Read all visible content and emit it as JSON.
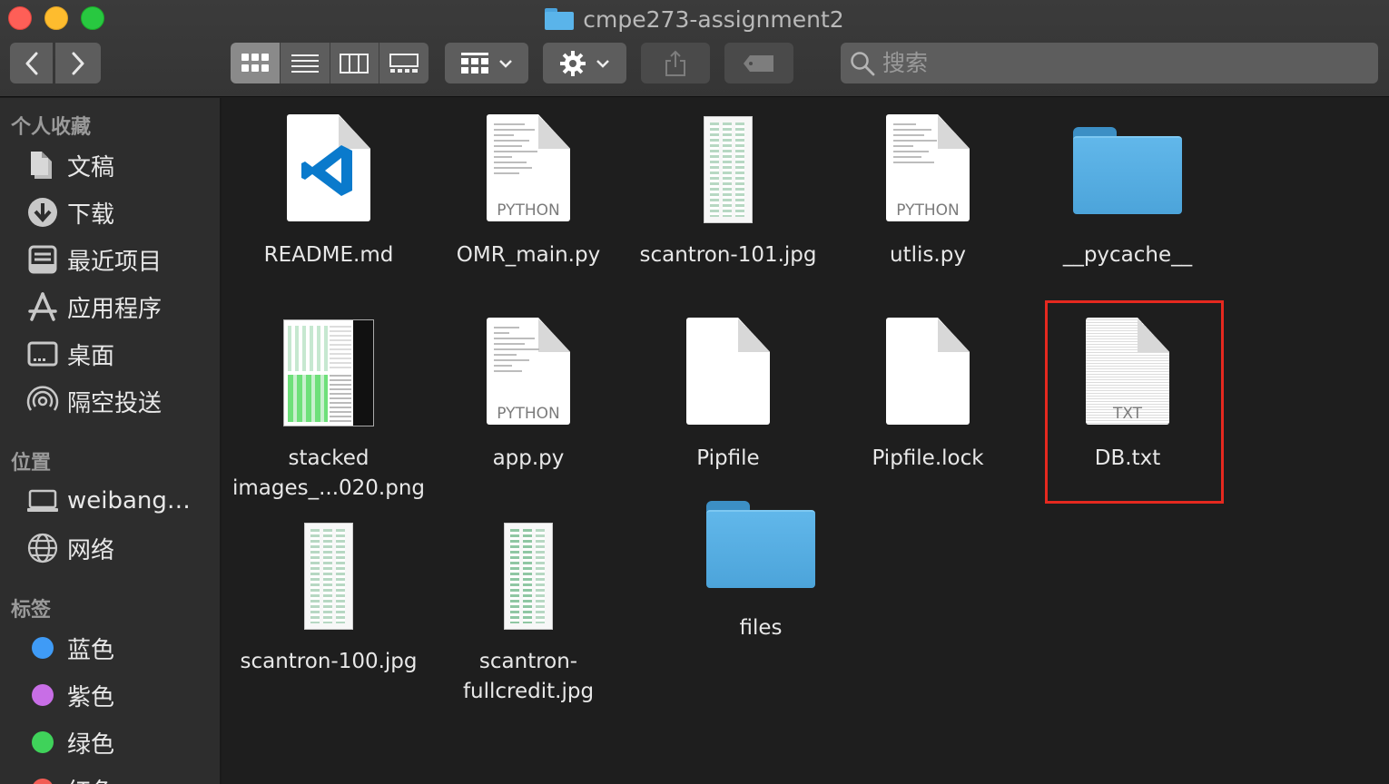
{
  "window": {
    "title": "cmpe273-assignment2"
  },
  "toolbar": {
    "search_placeholder": "搜索",
    "views": [
      "icon",
      "list",
      "column",
      "gallery"
    ],
    "active_view": "icon"
  },
  "sidebar": {
    "favorites_header": "个人收藏",
    "favorites": [
      {
        "label": "文稿",
        "icon": "documents-icon"
      },
      {
        "label": "下载",
        "icon": "downloads-icon"
      },
      {
        "label": "最近项目",
        "icon": "recents-icon"
      },
      {
        "label": "应用程序",
        "icon": "applications-icon"
      },
      {
        "label": "桌面",
        "icon": "desktop-icon"
      },
      {
        "label": "隔空投送",
        "icon": "airdrop-icon"
      }
    ],
    "locations_header": "位置",
    "locations": [
      {
        "label": "weibang…",
        "icon": "laptop-icon"
      },
      {
        "label": "网络",
        "icon": "network-icon"
      }
    ],
    "tags_header": "标签",
    "tags": [
      {
        "label": "蓝色",
        "color": "#3f9bf6"
      },
      {
        "label": "紫色",
        "color": "#c86ee6"
      },
      {
        "label": "绿色",
        "color": "#3fd25a"
      },
      {
        "label": "红色",
        "color": "#f25c54"
      }
    ]
  },
  "files": [
    {
      "name": "README.md",
      "kind": "vscode-doc"
    },
    {
      "name": "OMR_main.py",
      "kind": "python"
    },
    {
      "name": "scantron-101.jpg",
      "kind": "image"
    },
    {
      "name": "utlis.py",
      "kind": "python"
    },
    {
      "name": "__pycache__",
      "kind": "folder"
    },
    {
      "name_line1": "stacked",
      "name_line2": "images_...020.png",
      "kind": "image"
    },
    {
      "name": "app.py",
      "kind": "python"
    },
    {
      "name": "Pipfile",
      "kind": "blank"
    },
    {
      "name": "Pipfile.lock",
      "kind": "blank"
    },
    {
      "name": "DB.txt",
      "kind": "text",
      "highlighted": true
    },
    {
      "name": "scantron-100.jpg",
      "kind": "image"
    },
    {
      "name_line1": "scantron-",
      "name_line2": "fullcredit.jpg",
      "kind": "image"
    },
    {
      "name": "files",
      "kind": "folder"
    }
  ],
  "labels": {
    "python_ext": "PYTHON",
    "txt_ext": "TXT"
  },
  "colors": {
    "highlight": "#e5291f",
    "folder": "#5ab4ea",
    "vscode": "#0a7acc"
  }
}
